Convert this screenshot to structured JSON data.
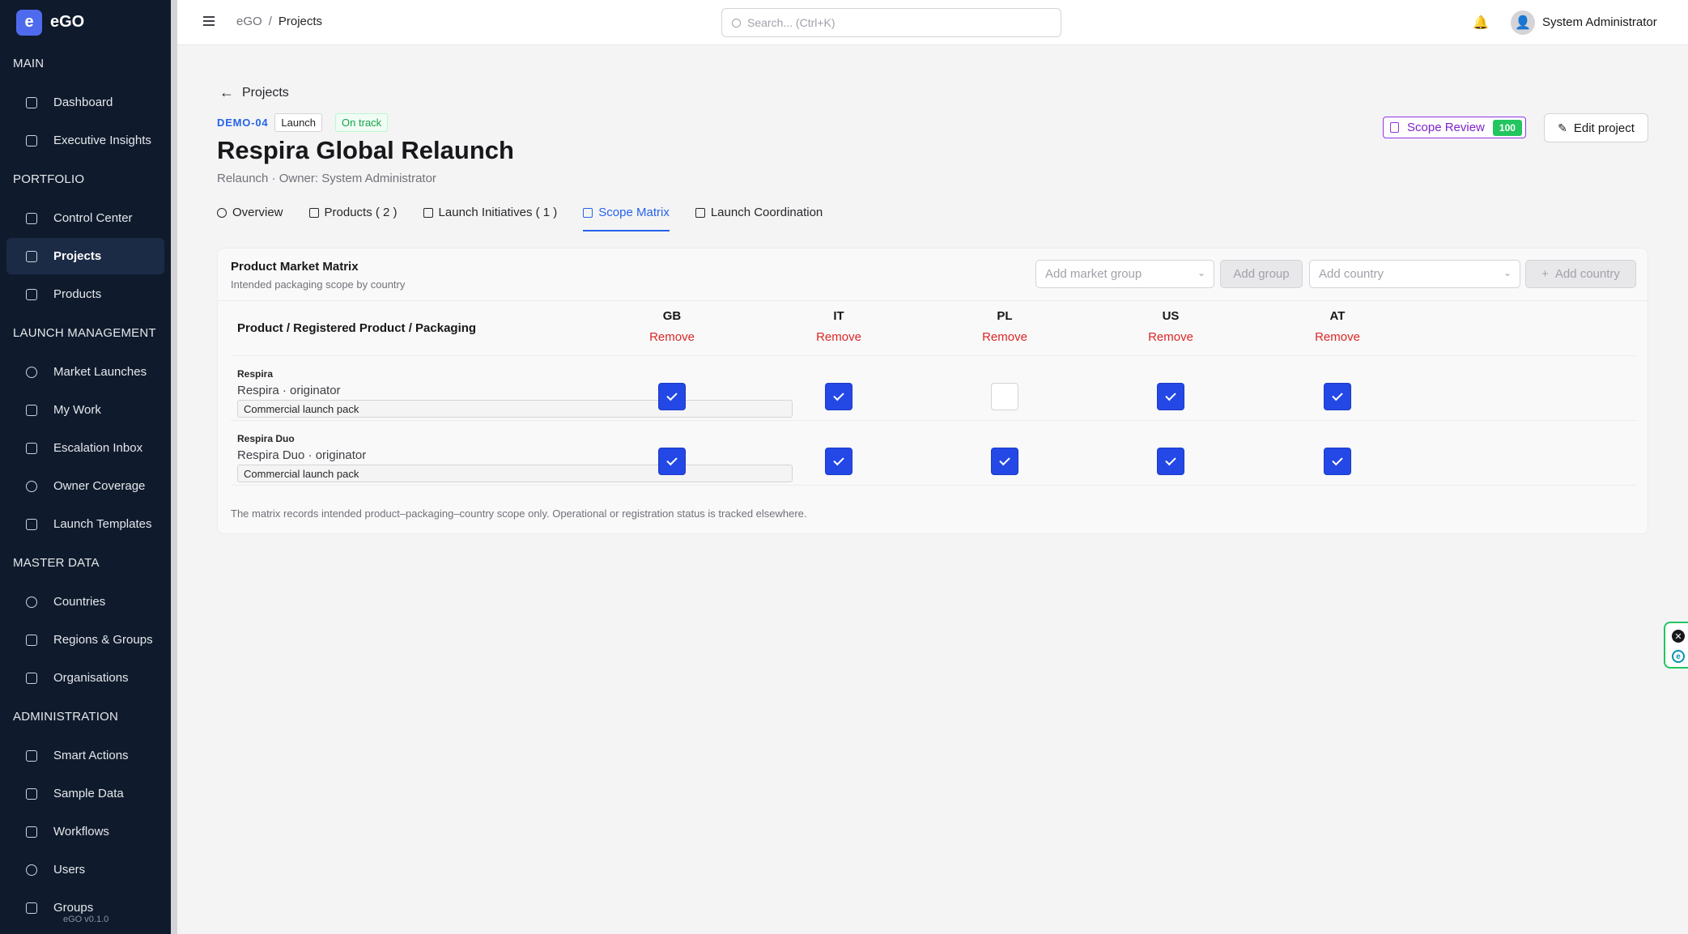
{
  "app": {
    "logo_letter": "e",
    "name": "eGO",
    "version": "eGO v0.1.0"
  },
  "sidebar": {
    "sections": [
      {
        "label": "MAIN",
        "items": [
          {
            "label": "Dashboard",
            "icon": "dashboard-icon"
          },
          {
            "label": "Executive Insights",
            "icon": "presentation-icon"
          }
        ]
      },
      {
        "label": "PORTFOLIO",
        "items": [
          {
            "label": "Control Center",
            "icon": "calendar-icon"
          },
          {
            "label": "Projects",
            "icon": "projects-icon",
            "active": true
          },
          {
            "label": "Products",
            "icon": "barcode-icon"
          }
        ]
      },
      {
        "label": "LAUNCH MANAGEMENT",
        "items": [
          {
            "label": "Market Launches",
            "icon": "rocket-icon"
          },
          {
            "label": "My Work",
            "icon": "checkbox-icon"
          },
          {
            "label": "Escalation Inbox",
            "icon": "escalation-icon"
          },
          {
            "label": "Owner Coverage",
            "icon": "users-icon"
          },
          {
            "label": "Launch Templates",
            "icon": "template-icon"
          }
        ]
      },
      {
        "label": "MASTER DATA",
        "items": [
          {
            "label": "Countries",
            "icon": "globe-icon"
          },
          {
            "label": "Regions & Groups",
            "icon": "network-icon"
          },
          {
            "label": "Organisations",
            "icon": "building-icon"
          }
        ]
      },
      {
        "label": "ADMINISTRATION",
        "items": [
          {
            "label": "Smart Actions",
            "icon": "bolt-icon"
          },
          {
            "label": "Sample Data",
            "icon": "database-icon"
          },
          {
            "label": "Workflows",
            "icon": "workflow-icon"
          },
          {
            "label": "Users",
            "icon": "user-icon"
          },
          {
            "label": "Groups",
            "icon": "group-icon"
          }
        ]
      }
    ]
  },
  "topbar": {
    "breadcrumb": {
      "root": "eGO",
      "separator": "/",
      "current": "Projects"
    },
    "search_placeholder": "Search... (Ctrl+K)",
    "bell_glyph": "🔔",
    "avatar_glyph": "👤",
    "user_name": "System Administrator"
  },
  "project": {
    "back_label": "Projects",
    "code": "DEMO-04",
    "type_badge": "Launch",
    "status_badge": "On track",
    "title": "Respira Global Relaunch",
    "subtitle": "Relaunch · Owner: System Administrator",
    "scope_review_label": "Scope Review",
    "scope_review_score": "100",
    "edit_label": "Edit project"
  },
  "tabs": [
    {
      "label": "Overview",
      "icon": "info-icon"
    },
    {
      "label": "Products ( 2 )",
      "icon": "barcode-icon"
    },
    {
      "label": "Launch Initiatives ( 1 )",
      "icon": "rocket-icon"
    },
    {
      "label": "Scope Matrix",
      "icon": "grid-icon",
      "active": true
    },
    {
      "label": "Launch Coordination",
      "icon": "users-icon"
    }
  ],
  "matrix": {
    "title": "Product Market Matrix",
    "subtitle": "Intended packaging scope by country",
    "market_group_placeholder": "Add market group",
    "add_group_label": "Add group",
    "country_placeholder": "Add country",
    "add_country_label": "Add country",
    "column_header": "Product / Registered Product / Packaging",
    "remove_label": "Remove",
    "countries": [
      "GB",
      "IT",
      "PL",
      "US",
      "AT"
    ],
    "rows": [
      {
        "product": "Respira",
        "registered": "Respira · originator",
        "packaging": "Commercial launch pack",
        "scope": [
          true,
          true,
          false,
          true,
          true
        ]
      },
      {
        "product": "Respira Duo",
        "registered": "Respira Duo · originator",
        "packaging": "Commercial launch pack",
        "scope": [
          true,
          true,
          true,
          true,
          true
        ]
      }
    ],
    "footnote": "The matrix records intended product–packaging–country scope only. Operational or registration status is tracked elsewhere."
  },
  "colors": {
    "accent": "#2563eb",
    "checkbox": "#2348e6",
    "danger": "#dc2626",
    "success": "#22c55e",
    "sidebar": "#0f1b2d",
    "scope_review": "#9333ea"
  }
}
